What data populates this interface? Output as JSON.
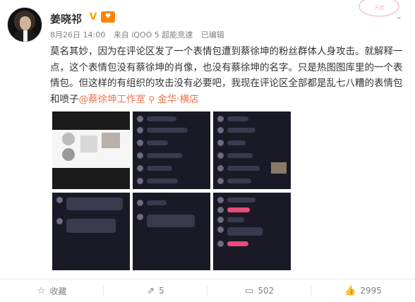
{
  "post": {
    "username": "姜晓祁",
    "verified_icon": "V",
    "member_icon": "♥",
    "date": "8月26日 14:00",
    "source": "来自 iQOO 5 超能竞速",
    "edited": "已编辑",
    "text_before_mention": "莫名其妙，因为在评论区发了一个表情包遭到蔡徐坤的粉丝群体人身攻击。就解释一点，这个表情包没有蔡徐坤的肖像，也没有蔡徐坤的名字。只是热图图库里的一个表情包。但这样的有组织的攻击没有必要吧，我现在评论区全部都是乱七八糟的表情包和喷子",
    "mention": "@蔡徐坤工作室",
    "location": "金华·横店",
    "stamp_text": "天选"
  },
  "images": [
    {
      "name": "meme-screenshot"
    },
    {
      "name": "comments-screenshot-1"
    },
    {
      "name": "comments-screenshot-2"
    },
    {
      "name": "comments-screenshot-3"
    },
    {
      "name": "comments-screenshot-4"
    },
    {
      "name": "comments-screenshot-5"
    }
  ],
  "actions": {
    "favorite": {
      "label": "收藏",
      "icon": "star-icon"
    },
    "repost": {
      "label": "5",
      "icon": "repost-icon"
    },
    "comment": {
      "label": "502",
      "icon": "comment-icon"
    },
    "like": {
      "label": "2995",
      "icon": "thumbs-up-icon"
    }
  },
  "colors": {
    "accent": "#eb7350",
    "verified": "#f7a800",
    "text": "#333333",
    "meta": "#808080"
  }
}
